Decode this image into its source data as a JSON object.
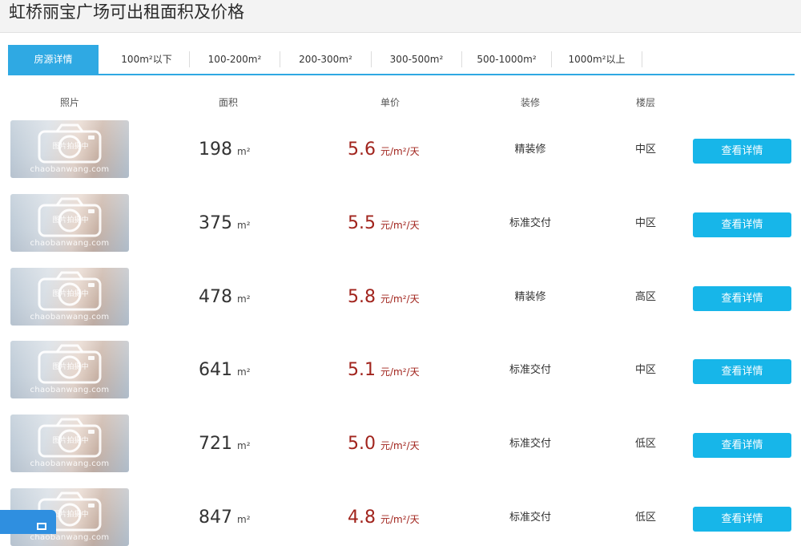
{
  "page": {
    "title": "虹桥丽宝广场可出租面积及价格"
  },
  "tabs": [
    {
      "label": "房源详情",
      "active": true
    },
    {
      "label": "100m²以下"
    },
    {
      "label": "100-200m²"
    },
    {
      "label": "200-300m²"
    },
    {
      "label": "300-500m²"
    },
    {
      "label": "500-1000m²"
    },
    {
      "label": "1000m²以上"
    }
  ],
  "columns": {
    "photo": "照片",
    "area": "面积",
    "price": "单价",
    "decoration": "装修",
    "floor": "楼层"
  },
  "photo_watermark": {
    "text": "图片拍摄中",
    "site": "chaobanwang.com"
  },
  "rows": [
    {
      "area": "198",
      "area_unit": "m²",
      "price": "5.6",
      "price_unit": "元/m²/天",
      "decoration": "精装修",
      "floor": "中区",
      "button": "查看详情"
    },
    {
      "area": "375",
      "area_unit": "m²",
      "price": "5.5",
      "price_unit": "元/m²/天",
      "decoration": "标准交付",
      "floor": "中区",
      "button": "查看详情"
    },
    {
      "area": "478",
      "area_unit": "m²",
      "price": "5.8",
      "price_unit": "元/m²/天",
      "decoration": "精装修",
      "floor": "高区",
      "button": "查看详情"
    },
    {
      "area": "641",
      "area_unit": "m²",
      "price": "5.1",
      "price_unit": "元/m²/天",
      "decoration": "标准交付",
      "floor": "中区",
      "button": "查看详情"
    },
    {
      "area": "721",
      "area_unit": "m²",
      "price": "5.0",
      "price_unit": "元/m²/天",
      "decoration": "标准交付",
      "floor": "低区",
      "button": "查看详情"
    },
    {
      "area": "847",
      "area_unit": "m²",
      "price": "4.8",
      "price_unit": "元/m²/天",
      "decoration": "标准交付",
      "floor": "低区",
      "button": "查看详情"
    }
  ],
  "colors": {
    "accent": "#2fa9e3",
    "button": "#17b6e9",
    "price": "#a1241d"
  }
}
